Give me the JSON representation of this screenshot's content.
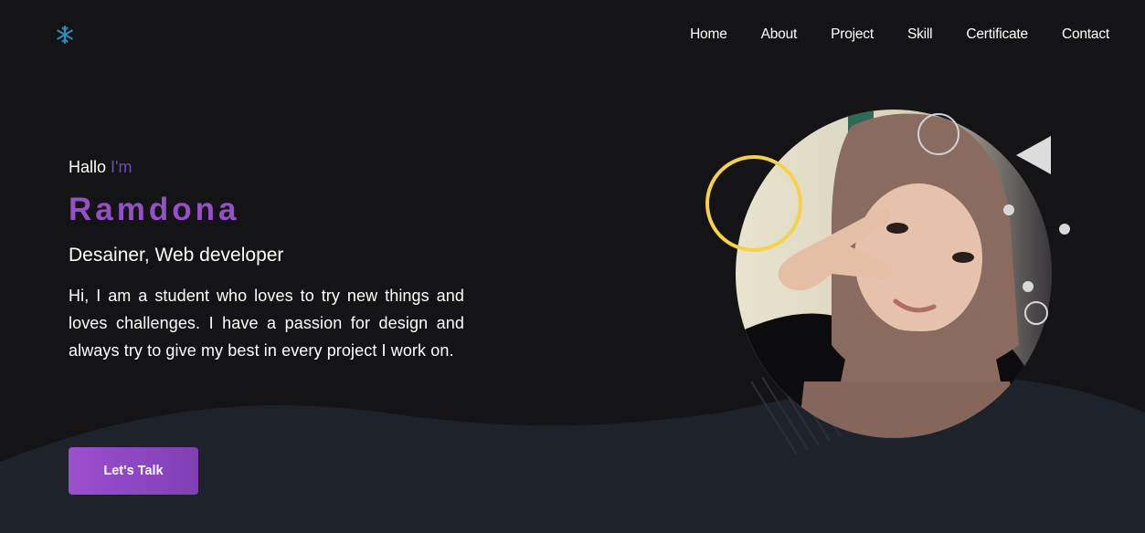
{
  "nav": {
    "logo_icon": "snowflake-icon",
    "items": [
      {
        "label": "Home"
      },
      {
        "label": "About"
      },
      {
        "label": "Project"
      },
      {
        "label": "Skill"
      },
      {
        "label": "Certificate"
      },
      {
        "label": "Contact"
      }
    ]
  },
  "hero": {
    "greeting": "Hallo",
    "greeting_highlight": "I'm",
    "name": "Ramdona",
    "role": "Desainer, Web developer",
    "description": "Hi, I am a student who loves to try new things and loves challenges. I have a passion for design and always try to give my best in every project I work on.",
    "cta_label": "Let's Talk"
  },
  "colors": {
    "background": "#141416",
    "wave": "#1e222b",
    "accent_purple": "#9650c6",
    "accent_yellow": "#f5d24a",
    "logo_cyan": "#2a8fbf"
  }
}
